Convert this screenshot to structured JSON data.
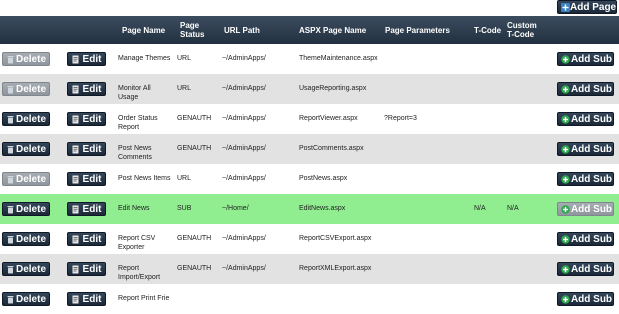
{
  "toolbar": {
    "add_page_label": "Add Page"
  },
  "columns": {
    "page_name": "Page Name",
    "page_status": "Page Status",
    "url_path": "URL Path",
    "aspx_page_name": "ASPX Page Name",
    "page_parameters": "Page Parameters",
    "t_code": "T-Code",
    "custom_t_code": "Custom T-Code"
  },
  "labels": {
    "delete": "Delete",
    "edit": "Edit",
    "add_sub": "Add Sub"
  },
  "colors": {
    "header": "#2e3e50",
    "row_alt": "#e2e2e2",
    "row_active": "#90ee90"
  },
  "rows": [
    {
      "page_name": "Manage Themes",
      "status": "URL",
      "url": "~/AdminApps/",
      "aspx": "ThemeMaintenance.aspx",
      "params": "",
      "tcode": "",
      "custom_tcode": "",
      "delete_enabled": false
    },
    {
      "page_name": "Monitor All Usage",
      "status": "URL",
      "url": "~/AdminApps/",
      "aspx": "UsageReporting.aspx",
      "params": "",
      "tcode": "",
      "custom_tcode": "",
      "delete_enabled": false
    },
    {
      "page_name": "Order Status Report",
      "status": "GENAUTH",
      "url": "~/AdminApps/",
      "aspx": "ReportViewer.aspx",
      "params": "?Report=3",
      "tcode": "",
      "custom_tcode": "",
      "delete_enabled": true
    },
    {
      "page_name": "Post News Comments",
      "status": "GENAUTH",
      "url": "~/AdminApps/",
      "aspx": "PostComments.aspx",
      "params": "",
      "tcode": "",
      "custom_tcode": "",
      "delete_enabled": true
    },
    {
      "page_name": "Post News Items",
      "status": "URL",
      "url": "~/AdminApps/",
      "aspx": "PostNews.aspx",
      "params": "",
      "tcode": "",
      "custom_tcode": "",
      "delete_enabled": false
    },
    {
      "page_name": "Edit News",
      "status": "SUB",
      "url": "~/Home/",
      "aspx": "EditNews.aspx",
      "params": "",
      "tcode": "N/A",
      "custom_tcode": "N/A",
      "delete_enabled": true
    },
    {
      "page_name": "Report CSV Exporter",
      "status": "GENAUTH",
      "url": "~/AdminApps/",
      "aspx": "ReportCSVExport.aspx",
      "params": "",
      "tcode": "",
      "custom_tcode": "",
      "delete_enabled": true
    },
    {
      "page_name": "Report Import/Export",
      "status": "GENAUTH",
      "url": "~/AdminApps/",
      "aspx": "ReportXMLExport.aspx",
      "params": "",
      "tcode": "",
      "custom_tcode": "",
      "delete_enabled": true
    },
    {
      "page_name": "Report Print Frie",
      "status": "",
      "url": "",
      "aspx": "",
      "params": "",
      "tcode": "",
      "custom_tcode": "",
      "delete_enabled": true
    }
  ]
}
